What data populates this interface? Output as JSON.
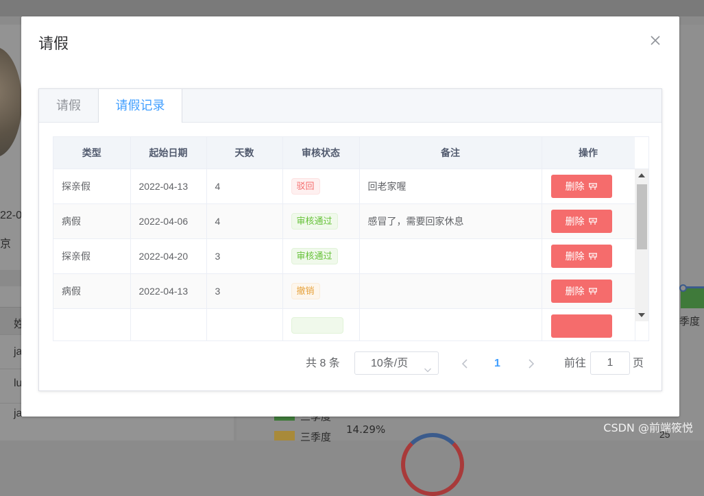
{
  "background": {
    "left_text_1": "22-0",
    "left_text_2": "京",
    "table_head_fragment": "姓",
    "row_fragments": [
      "ja",
      "lu",
      "ja"
    ],
    "chart_axis_label": "季度",
    "legend_labels": [
      "三季度",
      "三季度"
    ],
    "legend_colors": [
      "#3f7a3a",
      "#a88a3a"
    ],
    "percent_label": "14.29%",
    "axis_number": "25",
    "watermark": "CSDN @前端筱悦"
  },
  "dialog": {
    "title": "请假",
    "tabs": [
      {
        "label": "请假",
        "active": false
      },
      {
        "label": "请假记录",
        "active": true
      }
    ],
    "table": {
      "columns": [
        "类型",
        "起始日期",
        "天数",
        "审核状态",
        "备注",
        "操作"
      ],
      "rows": [
        {
          "type": "探亲假",
          "start_date": "2022-04-13",
          "days": "4",
          "status": "驳回",
          "status_kind": "danger",
          "note": "回老家喔",
          "action": "删除"
        },
        {
          "type": "病假",
          "start_date": "2022-04-06",
          "days": "4",
          "status": "审核通过",
          "status_kind": "success",
          "note": "感冒了，需要回家休息",
          "action": "删除"
        },
        {
          "type": "探亲假",
          "start_date": "2022-04-20",
          "days": "3",
          "status": "审核通过",
          "status_kind": "success",
          "note": "",
          "action": "删除"
        },
        {
          "type": "病假",
          "start_date": "2022-04-13",
          "days": "3",
          "status": "撤销",
          "status_kind": "warning",
          "note": "",
          "action": "删除"
        },
        {
          "type": "",
          "start_date": "",
          "days": "",
          "status": "",
          "status_kind": "success",
          "note": "",
          "action": ""
        }
      ]
    },
    "pagination": {
      "total": "共 8 条",
      "page_size": "10条/页",
      "current_page": "1",
      "goto_label": "前往",
      "goto_value": "1",
      "page_suffix": "页"
    }
  },
  "colors": {
    "primary": "#409eff",
    "danger": "#f56c6c",
    "success": "#67c23a",
    "warning": "#e6a23c"
  }
}
